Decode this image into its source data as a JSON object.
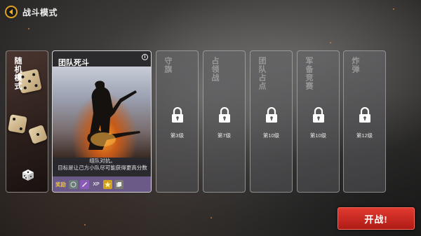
{
  "header": {
    "title": "战斗模式",
    "back_icon": "arrow-left-icon"
  },
  "modes": {
    "random": {
      "title": "随机模式",
      "icon": "dice-icon"
    },
    "team_deathmatch": {
      "title": "团队死斗",
      "info_icon": "i",
      "description_line1": "组队对抗。",
      "description_line2": "目标是让己方小队尽可能获得更高分数",
      "reward_label": "奖励",
      "reward_xp": "XP"
    },
    "locked": [
      {
        "title": "守旗",
        "level": "第3级"
      },
      {
        "title": "占领战",
        "level": "第7级"
      },
      {
        "title": "团队占点",
        "level": "第10级"
      },
      {
        "title": "军备竞赛",
        "level": "第10级"
      },
      {
        "title": "炸弹",
        "level": "第12级"
      }
    ]
  },
  "start_button": {
    "label": "开战!"
  },
  "colors": {
    "accent_red": "#c8251c",
    "back_ring": "#e0a020",
    "reward_bar": "#6b5a88",
    "reward_text": "#f0c030"
  }
}
